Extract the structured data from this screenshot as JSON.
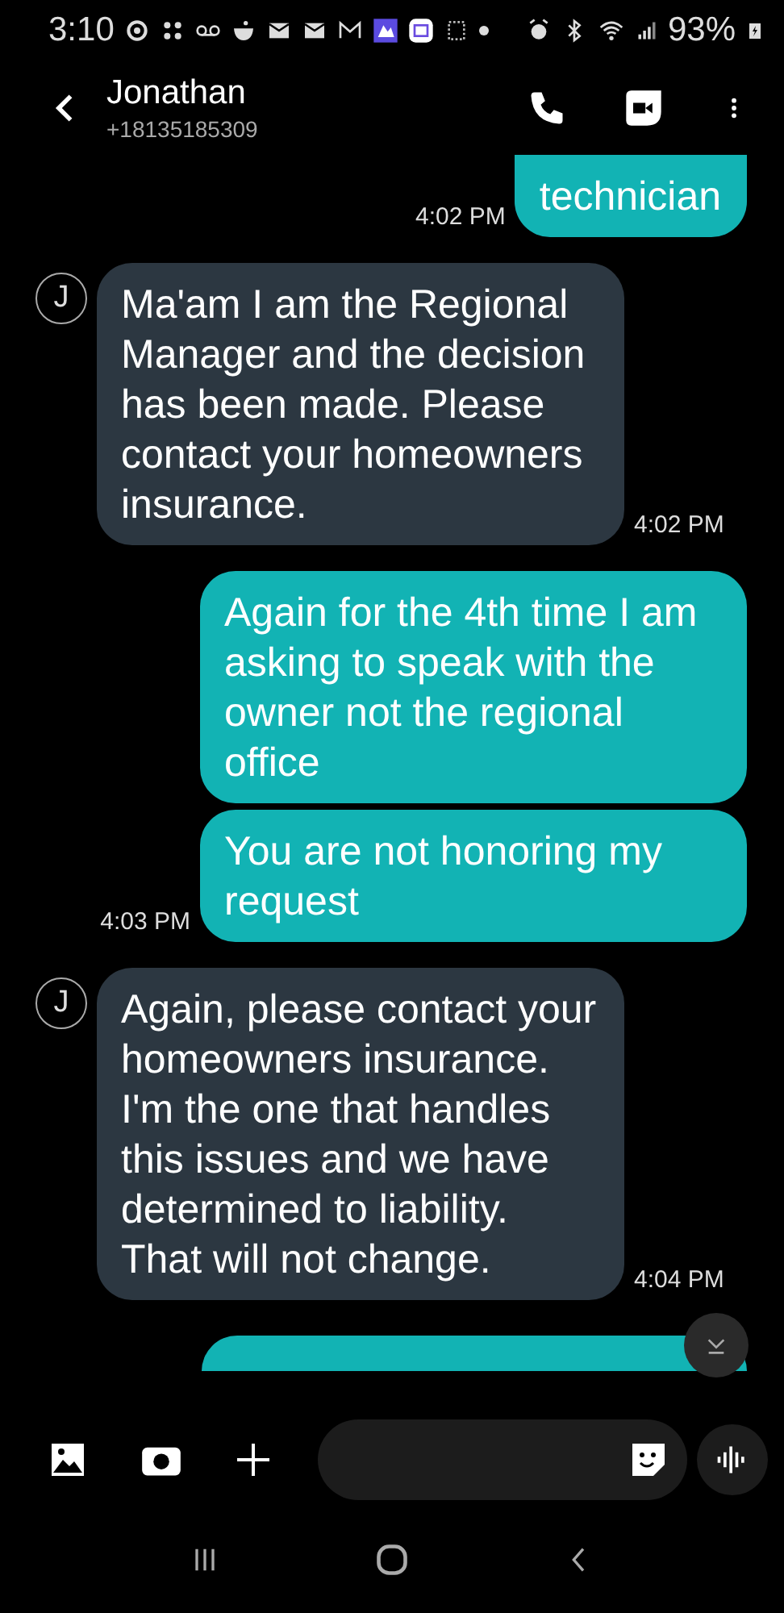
{
  "status_bar": {
    "time": "3:10",
    "battery": "93%"
  },
  "header": {
    "name": "Jonathan",
    "number": "+18135185309"
  },
  "messages": [
    {
      "kind": "sent",
      "bubbles": [
        "technician"
      ],
      "time": "4:02 PM"
    },
    {
      "kind": "received",
      "avatar": "J",
      "bubbles": [
        "Ma'am I am the Regional Manager and the decision has been made. Please contact your homeowners insurance."
      ],
      "time": "4:02 PM"
    },
    {
      "kind": "sent",
      "bubbles": [
        "Again for the 4th time I am asking to speak with the owner not the regional office",
        "You are not honoring my request"
      ],
      "time": "4:03 PM"
    },
    {
      "kind": "received",
      "avatar": "J",
      "bubbles": [
        "Again, please contact your homeowners insurance. I'm the one that handles this issues and we have determined to liability. That will not change."
      ],
      "time": "4:04 PM"
    },
    {
      "kind": "cut"
    }
  ]
}
